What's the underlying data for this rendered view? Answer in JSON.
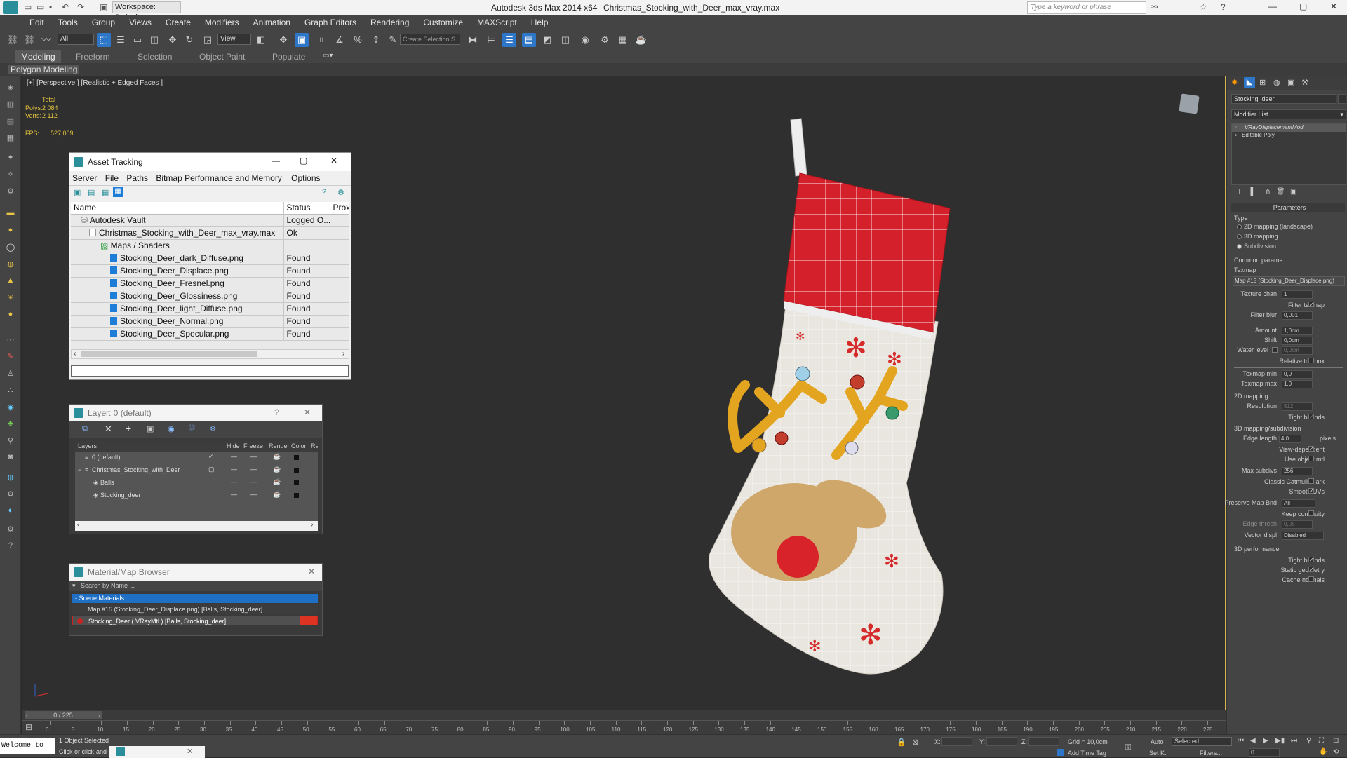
{
  "app": {
    "title": "Autodesk 3ds Max  2014 x64",
    "file": "Christmas_Stocking_with_Deer_max_vray.max",
    "workspace": "Workspace: Default",
    "search_placeholder": "Type a keyword or phrase"
  },
  "menu": [
    "Edit",
    "Tools",
    "Group",
    "Views",
    "Create",
    "Modifiers",
    "Animation",
    "Graph Editors",
    "Rendering",
    "Customize",
    "MAXScript",
    "Help"
  ],
  "toolbar": {
    "filter": "All",
    "view": "View",
    "selection_set": "Create Selection S"
  },
  "ribbon": {
    "tabs": [
      "Modeling",
      "Freeform",
      "Selection",
      "Object Paint",
      "Populate"
    ],
    "sub": "Polygon Modeling"
  },
  "viewport": {
    "label": "[+] [Perspective ] [Realistic + Edged Faces ]",
    "total_label": "Total",
    "polys_label": "Polys:",
    "polys": "2 084",
    "verts_label": "Verts:",
    "verts": "2 112",
    "fps_label": "FPS:",
    "fps": "527,009"
  },
  "asset_tracking": {
    "title": "Asset Tracking",
    "menu": [
      "Server",
      "File",
      "Paths",
      "Bitmap Performance and Memory",
      "Options"
    ],
    "columns": [
      "Name",
      "Status",
      "Prox"
    ],
    "rows": [
      {
        "name": "Autodesk Vault",
        "status": "Logged O..."
      },
      {
        "name": "Christmas_Stocking_with_Deer_max_vray.max",
        "status": "Ok"
      },
      {
        "name": "Maps / Shaders",
        "status": ""
      },
      {
        "name": "Stocking_Deer_dark_Diffuse.png",
        "status": "Found"
      },
      {
        "name": "Stocking_Deer_Displace.png",
        "status": "Found"
      },
      {
        "name": "Stocking_Deer_Fresnel.png",
        "status": "Found"
      },
      {
        "name": "Stocking_Deer_Glossiness.png",
        "status": "Found"
      },
      {
        "name": "Stocking_Deer_light_Diffuse.png",
        "status": "Found"
      },
      {
        "name": "Stocking_Deer_Normal.png",
        "status": "Found"
      },
      {
        "name": "Stocking_Deer_Specular.png",
        "status": "Found"
      }
    ]
  },
  "layers": {
    "title": "Layer: 0 (default)",
    "columns": [
      "Layers",
      "Hide",
      "Freeze",
      "Render",
      "Color",
      "Ra"
    ],
    "rows": [
      {
        "name": "0 (default)"
      },
      {
        "name": "Christmas_Stocking_with_Deer"
      },
      {
        "name": "Balls"
      },
      {
        "name": "Stocking_deer"
      }
    ]
  },
  "material_browser": {
    "title": "Material/Map Browser",
    "search_placeholder": "Search by Name ...",
    "group": "- Scene Materials",
    "items": [
      "Map #15 (Stocking_Deer_Displace.png) [Balls, Stocking_deer]",
      "Stocking_Deer  ( VRayMtl ) [Balls, Stocking_deer]"
    ]
  },
  "command_panel": {
    "object_name": "Stocking_deer",
    "modifier_list": "Modifier List",
    "stack": [
      "VRayDisplacementMod",
      "Editable Poly"
    ],
    "parameters": "Parameters",
    "type_label": "Type",
    "types": [
      "2D mapping (landscape)",
      "3D mapping",
      "Subdivision"
    ],
    "common_params": "Common params",
    "texmap_label": "Texmap",
    "texmap": "Map #15 (Stocking_Deer_Displace.png)",
    "texture_chan_label": "Texture chan",
    "texture_chan": "1",
    "filter_texmap": "Filter texmap",
    "filter_blur_label": "Filter blur",
    "filter_blur": "0,001",
    "amount_label": "Amount",
    "amount": "1,0cm",
    "shift_label": "Shift",
    "shift": "0,0cm",
    "water_level_label": "Water level",
    "water_level": "0,0cm",
    "relative_bbox": "Relative to bbox",
    "texmap_min_label": "Texmap min",
    "texmap_min": "0,0",
    "texmap_max_label": "Texmap max",
    "texmap_max": "1,0",
    "mapping2d": "2D mapping",
    "resolution_label": "Resolution",
    "resolution": "512",
    "tight_bounds": "Tight bounds",
    "mapping3d": "3D mapping/subdivision",
    "edge_length_label": "Edge length",
    "edge_length": "4,0",
    "pixels": "pixels",
    "view_dependent": "View-dependent",
    "use_object_mtl": "Use object mtl",
    "max_subdivs_label": "Max subdivs",
    "max_subdivs": "256",
    "classic_cc": "Classic Catmull-Clark",
    "smooth_uvs": "Smooth UVs",
    "preserve_map_bnd_label": "Preserve Map Bnd",
    "preserve_map_bnd": "All",
    "keep_continuity": "Keep continuity",
    "edge_thresh_label": "Edge thresh",
    "edge_thresh": "0,05",
    "vector_disp_label": "Vector displ",
    "vector_disp": "Disabled",
    "performance": "3D performance",
    "tight_bounds2": "Tight bounds",
    "static_geometry": "Static geometry",
    "cache_normals": "Cache normals"
  },
  "timeline": {
    "frame": "0 / 225",
    "ticks": [
      "0",
      "5",
      "10",
      "15",
      "20",
      "25",
      "30",
      "35",
      "40",
      "45",
      "50",
      "55",
      "60",
      "65",
      "70",
      "75",
      "80",
      "85",
      "90",
      "95",
      "100",
      "105",
      "110",
      "115",
      "120",
      "125",
      "130",
      "135",
      "140",
      "145",
      "150",
      "155",
      "160",
      "165",
      "170",
      "175",
      "180",
      "185",
      "190",
      "195",
      "200",
      "205",
      "210",
      "215",
      "220",
      "225"
    ]
  },
  "status": {
    "welcome": "Welcome to",
    "selected": "1 Object Selected",
    "prompt": "Click or click-and-dr",
    "x_label": "X:",
    "y_label": "Y:",
    "z_label": "Z:",
    "grid": "Grid = 10,0cm",
    "add_time_tag": "Add Time Tag",
    "auto": "Auto",
    "set_key": "Set K.",
    "selected_drop": "Selected",
    "filters": "Filters...",
    "frame": "0"
  }
}
